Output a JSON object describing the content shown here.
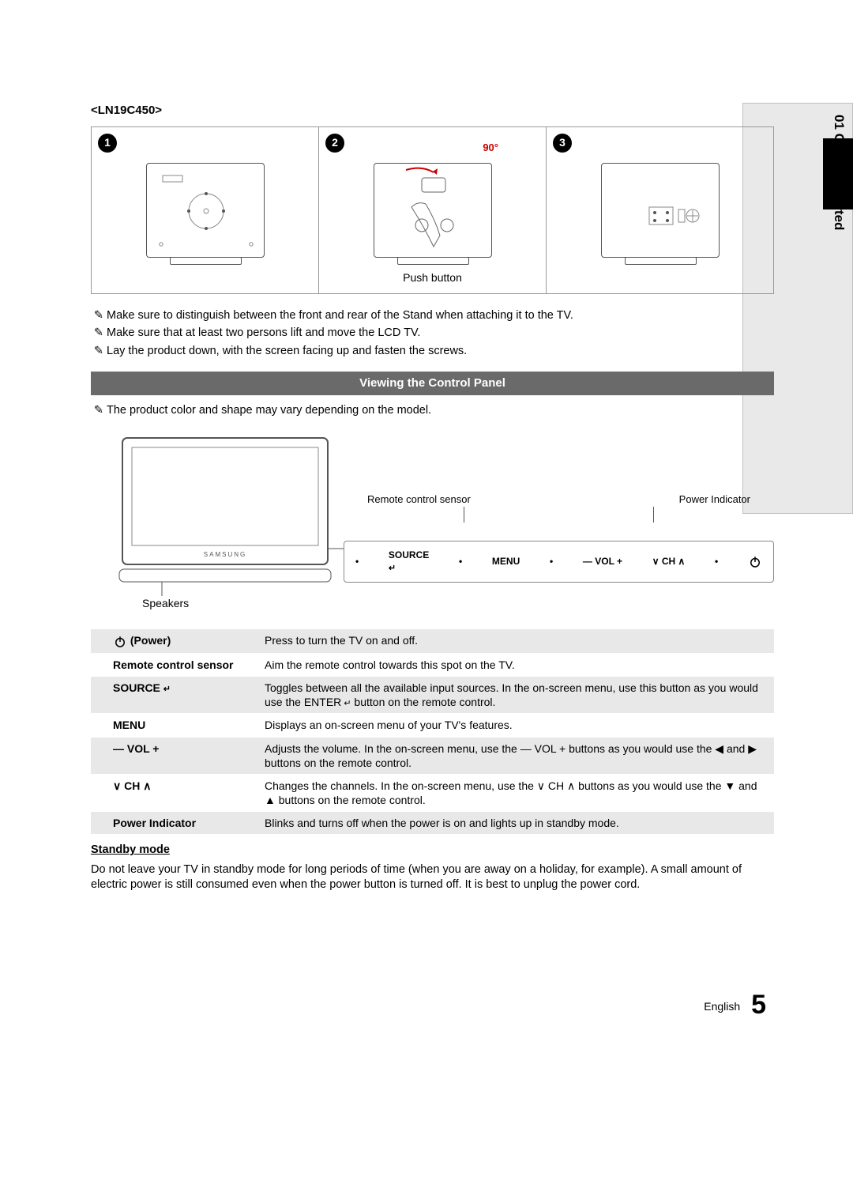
{
  "side": {
    "tab": "01  Getting Started"
  },
  "model": "<LN19C450>",
  "steps": {
    "s1": "1",
    "s2": "2",
    "s3": "3",
    "angle": "90°",
    "push": "Push button"
  },
  "notes": {
    "n1": "Make sure to distinguish between the front and rear of the Stand when attaching it to the TV.",
    "n2": "Make sure that at least two persons lift and move the LCD TV.",
    "n3": "Lay the product down, with the screen facing up and fasten the screws."
  },
  "section_title": "Viewing the Control Panel",
  "note_model": "The product color and shape may vary depending on the model.",
  "diagram": {
    "remote_sensor": "Remote control sensor",
    "power_indicator": "Power Indicator",
    "speakers": "Speakers",
    "btn_source": "SOURCE",
    "btn_menu": "MENU",
    "btn_vol": "—  VOL  +",
    "btn_ch": "∨  CH  ∧",
    "dot": "•"
  },
  "panel_table": [
    {
      "name_html": "power",
      "name": "(Power)",
      "desc": "Press to turn the TV on and off."
    },
    {
      "name": "Remote control sensor",
      "desc": "Aim the remote control towards this spot on the TV."
    },
    {
      "name": "SOURCE",
      "append_icon": "enter",
      "desc": "Toggles between all the available input sources. In the on-screen menu, use this button as you would use the ENTER",
      "desc_tail": " button on the remote control."
    },
    {
      "name": "MENU",
      "desc": "Displays an on-screen menu of your TV's features."
    },
    {
      "name": "—  VOL  +",
      "desc": "Adjusts the volume. In the on-screen menu, use the — VOL + buttons as you would use the ◀ and ▶ buttons on the remote control."
    },
    {
      "name": "∨  CH  ∧",
      "desc": "Changes the channels. In the on-screen menu, use the ∨ CH ∧ buttons as you would use the ▼ and ▲ buttons on the remote control."
    },
    {
      "name": "Power Indicator",
      "desc": "Blinks and turns off when the power is on and lights up in standby mode."
    }
  ],
  "standby": {
    "head": "Standby mode",
    "body": "Do not leave your TV in standby mode for long periods of time (when you are away on a holiday, for example). A small amount of electric power is still consumed even when the power button is turned off. It is best to unplug the power cord."
  },
  "footer": {
    "lang": "English",
    "page": "5"
  }
}
